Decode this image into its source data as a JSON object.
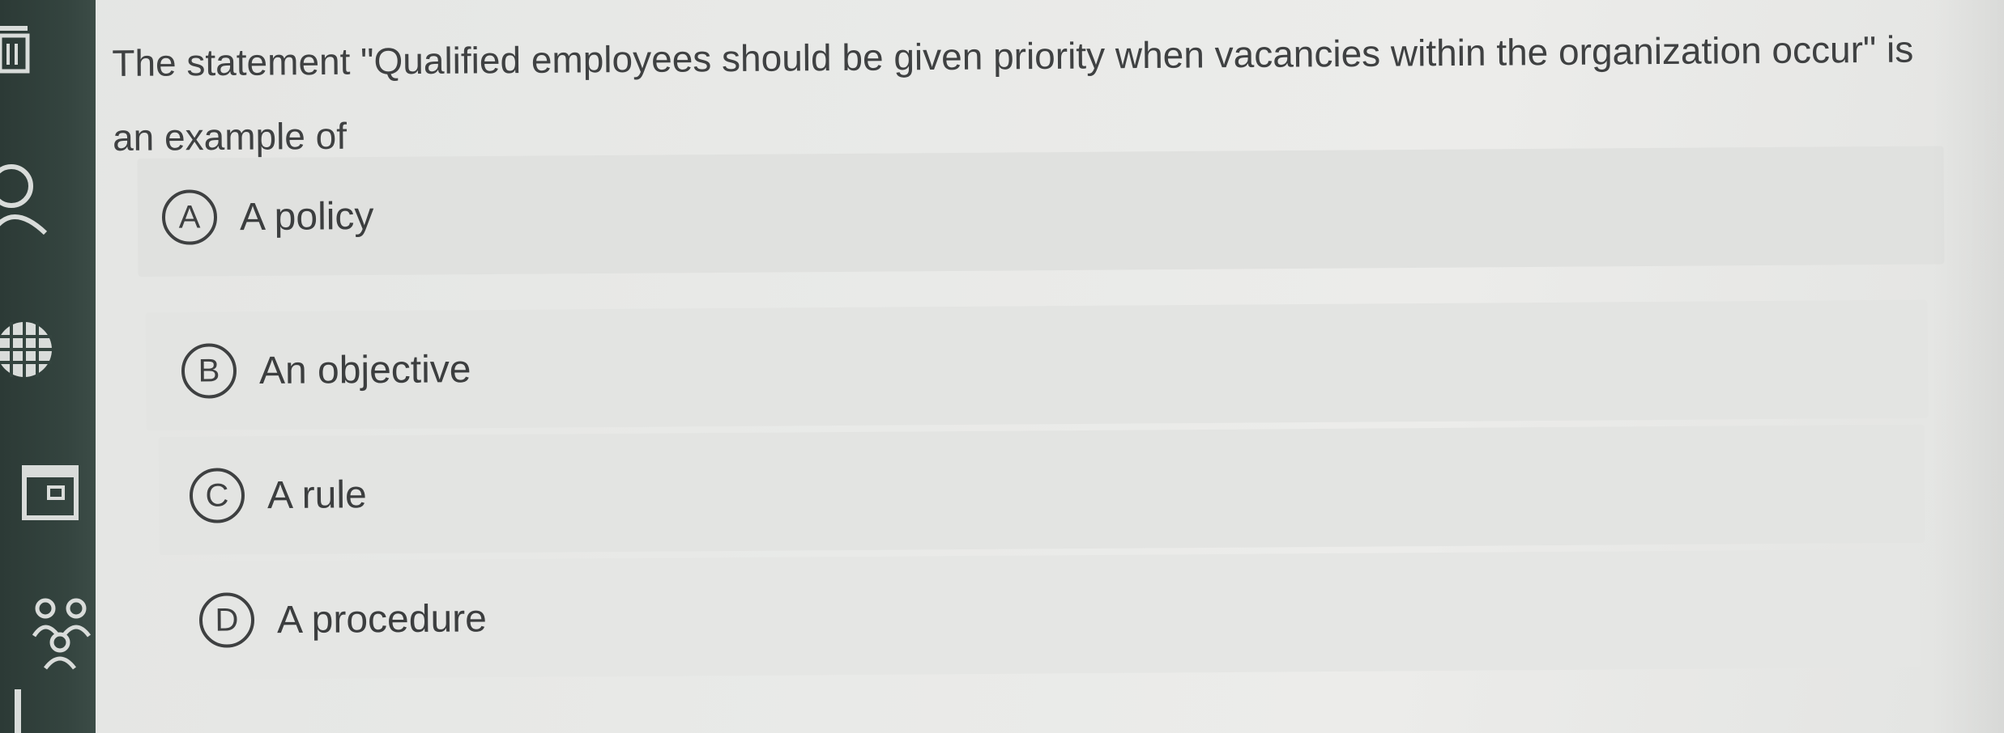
{
  "question": {
    "text": "The statement \"Qualified employees should be given priority when vacancies within the organization occur\" is an example of"
  },
  "options": [
    {
      "letter": "A",
      "text": "A policy"
    },
    {
      "letter": "B",
      "text": "An objective"
    },
    {
      "letter": "C",
      "text": "A rule"
    },
    {
      "letter": "D",
      "text": "A procedure"
    }
  ],
  "sidebar": {
    "icons": [
      "menu-icon",
      "user-icon",
      "globe-icon",
      "calendar-icon",
      "people-icon"
    ]
  },
  "colors": {
    "sidebar": "#34443f",
    "background": "#e9eae8",
    "text": "#3f4142",
    "icon": "#d9dcda"
  }
}
